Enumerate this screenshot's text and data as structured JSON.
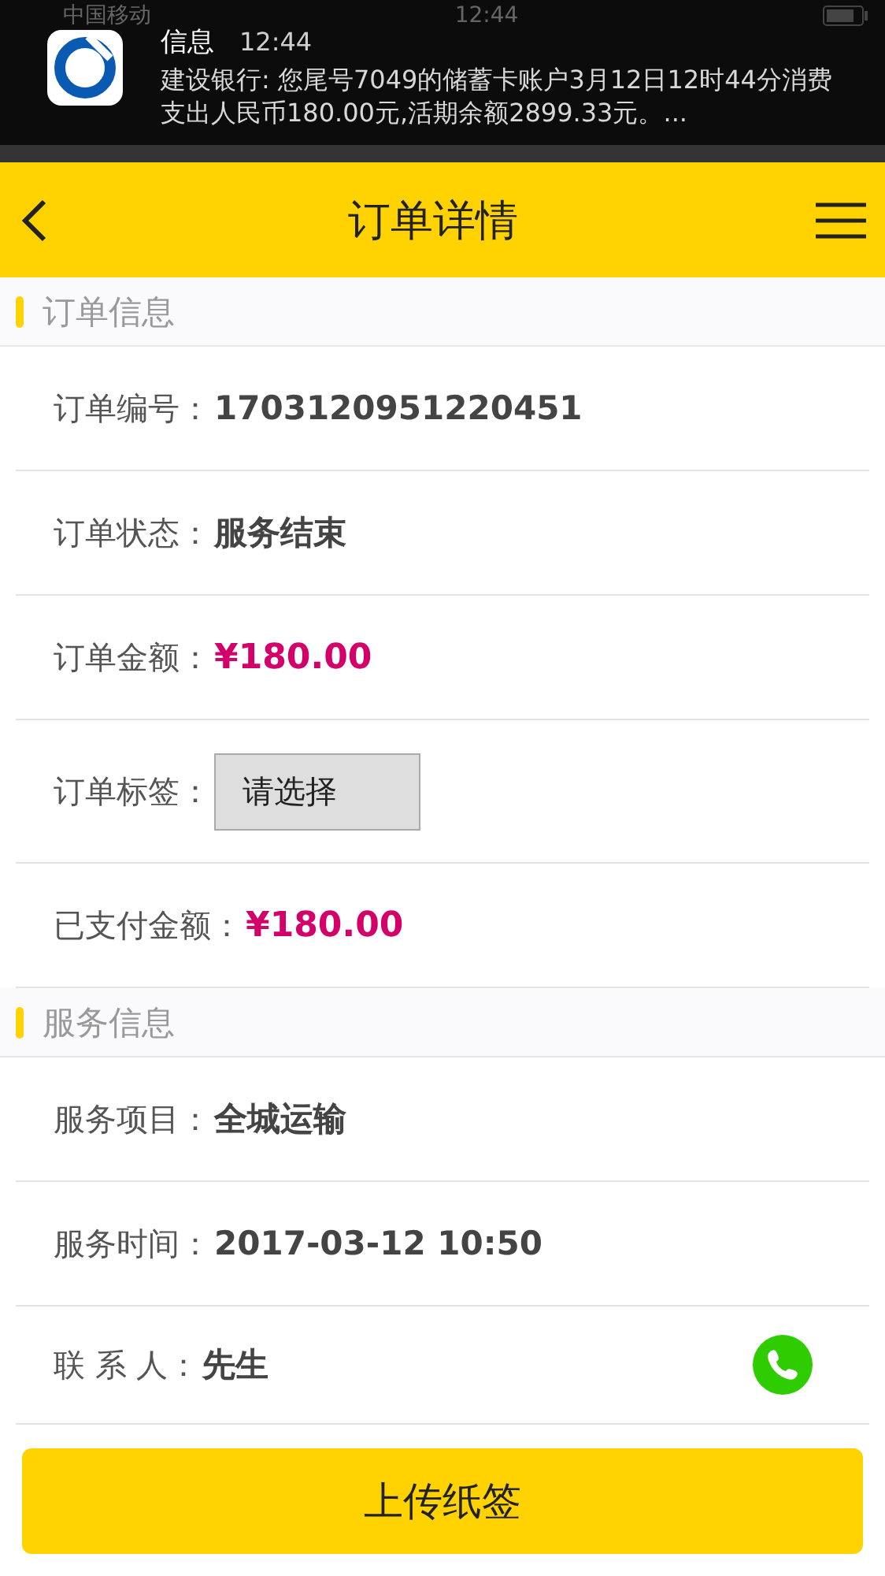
{
  "status_bar": {
    "carrier": "中国移动",
    "time": "12:44"
  },
  "notification": {
    "app": "信息",
    "time": "12:44",
    "message": "建设银行: 您尾号7049的储蓄卡账户3月12日12时44分消费支出人民币180.00元,活期余额2899.33元。..."
  },
  "header": {
    "title": "订单详情"
  },
  "sections": [
    {
      "title": "订单信息",
      "rows": [
        {
          "kind": "text",
          "label": "订单编号：",
          "value": "1703120951220451"
        },
        {
          "kind": "text",
          "label": "订单状态：",
          "value": "服务结束"
        },
        {
          "kind": "price",
          "label": "订单金额：",
          "currency": "¥",
          "value": "180.00"
        },
        {
          "kind": "select",
          "label": "订单标签：",
          "placeholder": "请选择"
        },
        {
          "kind": "price",
          "label": "已支付金额：",
          "currency": "¥",
          "value": "180.00"
        }
      ]
    },
    {
      "title": "服务信息",
      "rows": [
        {
          "kind": "text",
          "label": "服务项目：",
          "value": "全城运输"
        },
        {
          "kind": "text",
          "label": "服务时间：",
          "value": "2017-03-12 10:50"
        },
        {
          "kind": "contact",
          "label": "联 系 人：",
          "value": "先生"
        }
      ]
    }
  ],
  "footer_button": "上传纸签"
}
